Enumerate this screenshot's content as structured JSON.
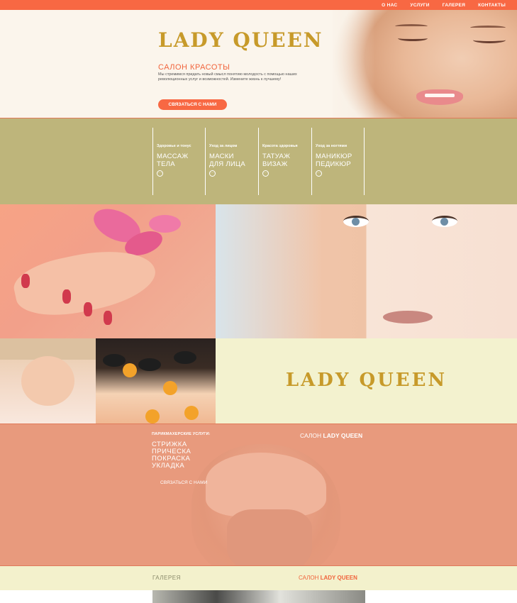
{
  "nav": {
    "items": [
      "О НАС",
      "УСЛУГИ",
      "ГАЛЕРЕЯ",
      "КОНТАКТЫ"
    ]
  },
  "hero": {
    "title": "LADY QUEEN",
    "subtitle": "САЛОН КРАСОТЫ",
    "description": "Мы стремимся придать новый смысл понятию молодость с помощью наших революционных услуг и возможностей. Измените жизнь к лучшему!",
    "cta": "СВЯЗАТЬСЯ С НАМИ"
  },
  "services": [
    {
      "category": "Здоровье и тонус",
      "name_line1": "МАССАЖ",
      "name_line2": "ТЕЛА",
      "more": "···"
    },
    {
      "category": "Уход за лицом",
      "name_line1": "МАСКИ",
      "name_line2": "ДЛЯ ЛИЦА",
      "more": "···"
    },
    {
      "category": "Красота здоровья",
      "name_line1": "ТАТУАЖ",
      "name_line2": "ВИЗАЖ",
      "more": "···"
    },
    {
      "category": "Уход за ногтями",
      "name_line1": "МАНИКЮР",
      "name_line2": "ПЕДИКЮР",
      "more": "···"
    }
  ],
  "logo_tile": {
    "text": "LADY QUEEN"
  },
  "hair": {
    "label": "ПАРИКМАХЕРСКИЕ УСЛУГИ:",
    "items": [
      "СТРИЖКА",
      "ПРИЧЕСКА",
      "ПОКРАСКА",
      "УКЛАДКА"
    ],
    "cta": "СВЯЗАТЬСЯ С НАМИ",
    "salon_prefix": "САЛОН",
    "salon_name": "LADY QUEEN"
  },
  "bottom": {
    "gallery": "ГАЛЕРЕЯ",
    "salon_prefix": "САЛОН",
    "salon_name": "LADY QUEEN"
  },
  "colors": {
    "accent": "#f86843",
    "gold": "#c79a2a",
    "olive": "#beb57b",
    "salmon": "#e89a7d",
    "cream": "#f3f2cf"
  }
}
